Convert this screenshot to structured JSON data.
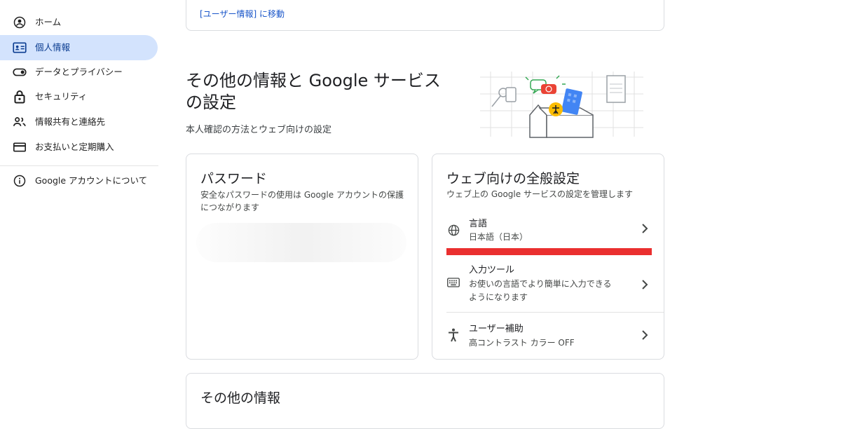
{
  "sidebar": {
    "items": [
      {
        "label": "ホーム",
        "icon": "account-circle-icon"
      },
      {
        "label": "個人情報",
        "icon": "id-card-icon",
        "active": true
      },
      {
        "label": "データとプライバシー",
        "icon": "toggle-icon"
      },
      {
        "label": "セキュリティ",
        "icon": "lock-icon"
      },
      {
        "label": "情報共有と連絡先",
        "icon": "people-icon"
      },
      {
        "label": "お支払いと定期購入",
        "icon": "credit-card-icon"
      }
    ],
    "about": {
      "label": "Google アカウントについて",
      "icon": "info-icon"
    }
  },
  "top_card": {
    "link": "[ユーザー情報] に移動"
  },
  "section": {
    "title": "その他の情報と Google サービスの設定",
    "subtitle": "本人確認の方法とウェブ向けの設定"
  },
  "password_card": {
    "title": "パスワード",
    "description": "安全なパスワードの使用は Google アカウントの保護につながります"
  },
  "web_settings_card": {
    "title": "ウェブ向けの全般設定",
    "description": "ウェブ上の Google サービスの設定を管理します",
    "rows": [
      {
        "title": "言語",
        "value": "日本語（日本）",
        "icon": "globe-icon"
      },
      {
        "title": "入力ツール",
        "value": "お使いの言語でより簡単に入力できるようになります",
        "icon": "keyboard-icon"
      },
      {
        "title": "ユーザー補助",
        "value": "高コントラスト カラー OFF",
        "icon": "accessibility-icon"
      }
    ]
  },
  "other_card": {
    "title": "その他の情報"
  },
  "colors": {
    "accent": "#d3e3fd",
    "link": "#1a56c9",
    "highlight": "#ea2f2f"
  }
}
